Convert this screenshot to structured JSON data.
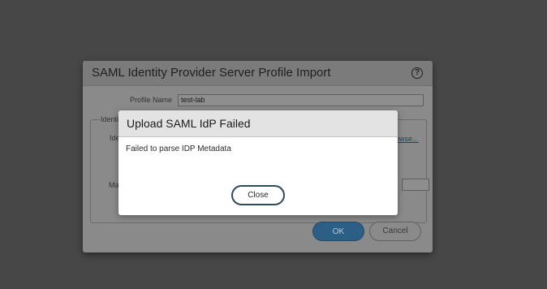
{
  "background_dialog": {
    "title": "SAML Identity Provider Server Profile Import",
    "help_icon": "help-icon",
    "profile_name_label": "Profile Name",
    "profile_name_value": "test-lab",
    "fieldset_legend": "Identi",
    "row_label_1": "Ide",
    "row_label_2": "Ma",
    "browse_link": "owse...",
    "ok_label": "OK",
    "cancel_label": "Cancel"
  },
  "error_modal": {
    "title": "Upload SAML IdP Failed",
    "message": "Failed to parse IDP Metadata",
    "close_label": "Close"
  },
  "colors": {
    "page_background": "#474747",
    "ok_button": "#2b5f86",
    "modal_background": "#ffffff",
    "modal_header": "#e3e3e3"
  }
}
